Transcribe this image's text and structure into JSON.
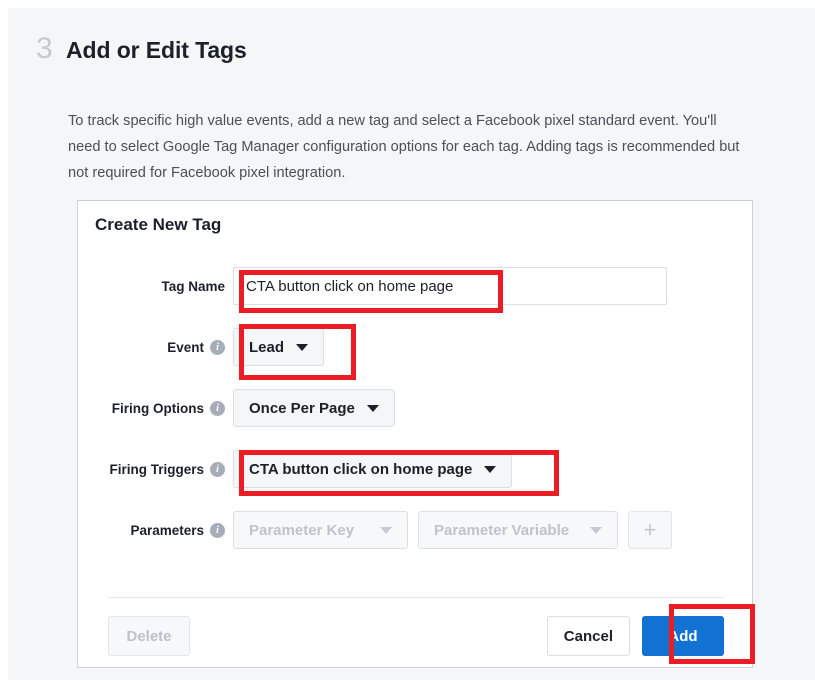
{
  "step": {
    "number": "3",
    "title": "Add or Edit Tags",
    "description": "To track specific high value events, add a new tag and select a Facebook pixel standard event. You'll need to select Google Tag Manager configuration options for each tag. Adding tags is recommended but not required for Facebook pixel integration."
  },
  "card": {
    "title": "Create New Tag",
    "fields": {
      "tag_name": {
        "label": "Tag Name",
        "value": "CTA button click on home page",
        "placeholder": ""
      },
      "event": {
        "label": "Event",
        "value": "Lead",
        "info_icon": "info-icon"
      },
      "firing_options": {
        "label": "Firing Options",
        "value": "Once Per Page",
        "info_icon": "info-icon"
      },
      "firing_triggers": {
        "label": "Firing Triggers",
        "value": "CTA button click on home page",
        "info_icon": "info-icon"
      },
      "parameters": {
        "label": "Parameters",
        "info_icon": "info-icon",
        "key_placeholder": "Parameter Key",
        "variable_placeholder": "Parameter Variable",
        "add_parameter_icon": "plus-icon"
      }
    },
    "footer": {
      "delete_label": "Delete",
      "cancel_label": "Cancel",
      "add_label": "Add"
    }
  },
  "colors": {
    "page_background": "#f5f6f7",
    "card_background": "#ffffff",
    "primary_button": "#1272d4",
    "annotation_highlight": "#ec1c24",
    "step_number": "#c6cace",
    "disabled_text": "#bec3cc"
  },
  "annotations": [
    {
      "name": "tag-name-highlight",
      "target": "tag_name"
    },
    {
      "name": "event-highlight",
      "target": "event"
    },
    {
      "name": "firing-triggers-highlight",
      "target": "firing_triggers"
    },
    {
      "name": "add-button-highlight",
      "target": "add_button"
    }
  ]
}
